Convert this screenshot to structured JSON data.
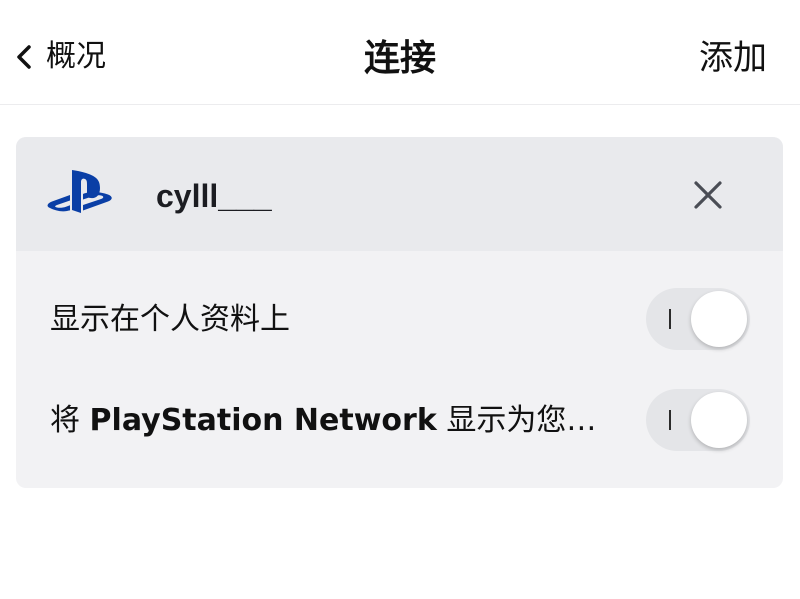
{
  "nav": {
    "back_label": "概况",
    "title": "连接",
    "add_label": "添加"
  },
  "connection": {
    "service_icon": "playstation-logo-icon",
    "account_name": "cylll___",
    "remove_icon": "close-icon"
  },
  "settings": [
    {
      "label": "显示在个人资料上",
      "enabled": true
    },
    {
      "label_prefix": "将 ",
      "label_bold": "PlayStation Network",
      "label_suffix": " 显示为您…",
      "enabled": true
    }
  ],
  "colors": {
    "brand_playstation": "#0a3fa6",
    "card_bg": "#f2f2f4",
    "card_header_bg": "#e9eaed",
    "toggle_track": "#e4e5e8"
  }
}
